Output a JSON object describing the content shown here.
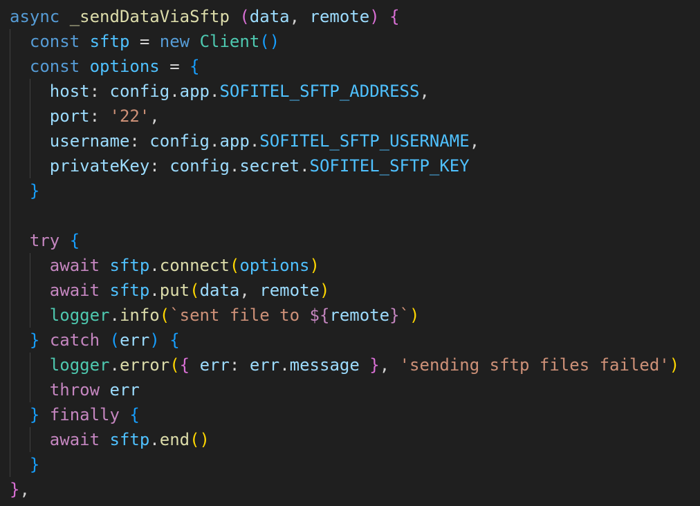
{
  "theme": {
    "background": "#1f1f1f",
    "indent_guide": "#404040",
    "colors": {
      "storage": "#569cd6",
      "fn": "#dcdcaa",
      "var": "#9cdcfe",
      "const": "#4fc1ff",
      "cls": "#4ec9b0",
      "ctrl": "#c586c0",
      "str": "#ce9178",
      "punc": "#d4d4d4",
      "b1": "#ffd700",
      "b2": "#da70d6",
      "b3": "#179fff"
    }
  },
  "code": {
    "lines": [
      {
        "tokens": [
          {
            "t": "async",
            "c": "storage"
          },
          {
            "t": " ",
            "c": "punc"
          },
          {
            "t": "_sendDataViaSftp",
            "c": "fn"
          },
          {
            "t": " ",
            "c": "punc"
          },
          {
            "t": "(",
            "c": "b2"
          },
          {
            "t": "data",
            "c": "var"
          },
          {
            "t": ", ",
            "c": "punc"
          },
          {
            "t": "remote",
            "c": "var"
          },
          {
            "t": ")",
            "c": "b2"
          },
          {
            "t": " ",
            "c": "punc"
          },
          {
            "t": "{",
            "c": "b2"
          }
        ]
      },
      {
        "tokens": [
          {
            "t": "  ",
            "c": "punc"
          },
          {
            "t": "const",
            "c": "storage"
          },
          {
            "t": " ",
            "c": "punc"
          },
          {
            "t": "sftp",
            "c": "const"
          },
          {
            "t": " = ",
            "c": "punc"
          },
          {
            "t": "new",
            "c": "storage"
          },
          {
            "t": " ",
            "c": "punc"
          },
          {
            "t": "Client",
            "c": "cls"
          },
          {
            "t": "()",
            "c": "b3"
          }
        ]
      },
      {
        "tokens": [
          {
            "t": "  ",
            "c": "punc"
          },
          {
            "t": "const",
            "c": "storage"
          },
          {
            "t": " ",
            "c": "punc"
          },
          {
            "t": "options",
            "c": "const"
          },
          {
            "t": " = ",
            "c": "punc"
          },
          {
            "t": "{",
            "c": "b3"
          }
        ]
      },
      {
        "tokens": [
          {
            "t": "    ",
            "c": "punc"
          },
          {
            "t": "host",
            "c": "var"
          },
          {
            "t": ": ",
            "c": "punc"
          },
          {
            "t": "config",
            "c": "var"
          },
          {
            "t": ".",
            "c": "punc"
          },
          {
            "t": "app",
            "c": "var"
          },
          {
            "t": ".",
            "c": "punc"
          },
          {
            "t": "SOFITEL_SFTP_ADDRESS",
            "c": "const"
          },
          {
            "t": ",",
            "c": "punc"
          }
        ]
      },
      {
        "tokens": [
          {
            "t": "    ",
            "c": "punc"
          },
          {
            "t": "port",
            "c": "var"
          },
          {
            "t": ": ",
            "c": "punc"
          },
          {
            "t": "'22'",
            "c": "str"
          },
          {
            "t": ",",
            "c": "punc"
          }
        ]
      },
      {
        "tokens": [
          {
            "t": "    ",
            "c": "punc"
          },
          {
            "t": "username",
            "c": "var"
          },
          {
            "t": ": ",
            "c": "punc"
          },
          {
            "t": "config",
            "c": "var"
          },
          {
            "t": ".",
            "c": "punc"
          },
          {
            "t": "app",
            "c": "var"
          },
          {
            "t": ".",
            "c": "punc"
          },
          {
            "t": "SOFITEL_SFTP_USERNAME",
            "c": "const"
          },
          {
            "t": ",",
            "c": "punc"
          }
        ]
      },
      {
        "tokens": [
          {
            "t": "    ",
            "c": "punc"
          },
          {
            "t": "privateKey",
            "c": "var"
          },
          {
            "t": ": ",
            "c": "punc"
          },
          {
            "t": "config",
            "c": "var"
          },
          {
            "t": ".",
            "c": "punc"
          },
          {
            "t": "secret",
            "c": "var"
          },
          {
            "t": ".",
            "c": "punc"
          },
          {
            "t": "SOFITEL_SFTP_KEY",
            "c": "const"
          }
        ]
      },
      {
        "tokens": [
          {
            "t": "  ",
            "c": "punc"
          },
          {
            "t": "}",
            "c": "b3"
          }
        ]
      },
      {
        "tokens": []
      },
      {
        "tokens": [
          {
            "t": "  ",
            "c": "punc"
          },
          {
            "t": "try",
            "c": "ctrl"
          },
          {
            "t": " ",
            "c": "punc"
          },
          {
            "t": "{",
            "c": "b3"
          }
        ]
      },
      {
        "tokens": [
          {
            "t": "    ",
            "c": "punc"
          },
          {
            "t": "await",
            "c": "ctrl"
          },
          {
            "t": " ",
            "c": "punc"
          },
          {
            "t": "sftp",
            "c": "const"
          },
          {
            "t": ".",
            "c": "punc"
          },
          {
            "t": "connect",
            "c": "fn"
          },
          {
            "t": "(",
            "c": "b1"
          },
          {
            "t": "options",
            "c": "const"
          },
          {
            "t": ")",
            "c": "b1"
          }
        ]
      },
      {
        "tokens": [
          {
            "t": "    ",
            "c": "punc"
          },
          {
            "t": "await",
            "c": "ctrl"
          },
          {
            "t": " ",
            "c": "punc"
          },
          {
            "t": "sftp",
            "c": "const"
          },
          {
            "t": ".",
            "c": "punc"
          },
          {
            "t": "put",
            "c": "fn"
          },
          {
            "t": "(",
            "c": "b1"
          },
          {
            "t": "data",
            "c": "var"
          },
          {
            "t": ", ",
            "c": "punc"
          },
          {
            "t": "remote",
            "c": "var"
          },
          {
            "t": ")",
            "c": "b1"
          }
        ]
      },
      {
        "tokens": [
          {
            "t": "    ",
            "c": "punc"
          },
          {
            "t": "logger",
            "c": "cls"
          },
          {
            "t": ".",
            "c": "punc"
          },
          {
            "t": "info",
            "c": "fn"
          },
          {
            "t": "(",
            "c": "b1"
          },
          {
            "t": "`sent file to ",
            "c": "str"
          },
          {
            "t": "${",
            "c": "ctrl"
          },
          {
            "t": "remote",
            "c": "var"
          },
          {
            "t": "}",
            "c": "ctrl"
          },
          {
            "t": "`",
            "c": "str"
          },
          {
            "t": ")",
            "c": "b1"
          }
        ]
      },
      {
        "tokens": [
          {
            "t": "  ",
            "c": "punc"
          },
          {
            "t": "}",
            "c": "b3"
          },
          {
            "t": " ",
            "c": "punc"
          },
          {
            "t": "catch",
            "c": "ctrl"
          },
          {
            "t": " ",
            "c": "punc"
          },
          {
            "t": "(",
            "c": "b3"
          },
          {
            "t": "err",
            "c": "var"
          },
          {
            "t": ")",
            "c": "b3"
          },
          {
            "t": " ",
            "c": "punc"
          },
          {
            "t": "{",
            "c": "b3"
          }
        ]
      },
      {
        "tokens": [
          {
            "t": "    ",
            "c": "punc"
          },
          {
            "t": "logger",
            "c": "cls"
          },
          {
            "t": ".",
            "c": "punc"
          },
          {
            "t": "error",
            "c": "fn"
          },
          {
            "t": "(",
            "c": "b1"
          },
          {
            "t": "{",
            "c": "b2"
          },
          {
            "t": " ",
            "c": "punc"
          },
          {
            "t": "err",
            "c": "var"
          },
          {
            "t": ": ",
            "c": "punc"
          },
          {
            "t": "err",
            "c": "var"
          },
          {
            "t": ".",
            "c": "punc"
          },
          {
            "t": "message",
            "c": "var"
          },
          {
            "t": " ",
            "c": "punc"
          },
          {
            "t": "}",
            "c": "b2"
          },
          {
            "t": ", ",
            "c": "punc"
          },
          {
            "t": "'sending sftp files failed'",
            "c": "str"
          },
          {
            "t": ")",
            "c": "b1"
          }
        ]
      },
      {
        "tokens": [
          {
            "t": "    ",
            "c": "punc"
          },
          {
            "t": "throw",
            "c": "ctrl"
          },
          {
            "t": " ",
            "c": "punc"
          },
          {
            "t": "err",
            "c": "var"
          }
        ]
      },
      {
        "tokens": [
          {
            "t": "  ",
            "c": "punc"
          },
          {
            "t": "}",
            "c": "b3"
          },
          {
            "t": " ",
            "c": "punc"
          },
          {
            "t": "finally",
            "c": "ctrl"
          },
          {
            "t": " ",
            "c": "punc"
          },
          {
            "t": "{",
            "c": "b3"
          }
        ]
      },
      {
        "tokens": [
          {
            "t": "    ",
            "c": "punc"
          },
          {
            "t": "await",
            "c": "ctrl"
          },
          {
            "t": " ",
            "c": "punc"
          },
          {
            "t": "sftp",
            "c": "const"
          },
          {
            "t": ".",
            "c": "punc"
          },
          {
            "t": "end",
            "c": "fn"
          },
          {
            "t": "()",
            "c": "b1"
          }
        ]
      },
      {
        "tokens": [
          {
            "t": "  ",
            "c": "punc"
          },
          {
            "t": "}",
            "c": "b3"
          }
        ]
      },
      {
        "tokens": [
          {
            "t": "}",
            "c": "b2"
          },
          {
            "t": ",",
            "c": "punc"
          }
        ]
      }
    ]
  }
}
